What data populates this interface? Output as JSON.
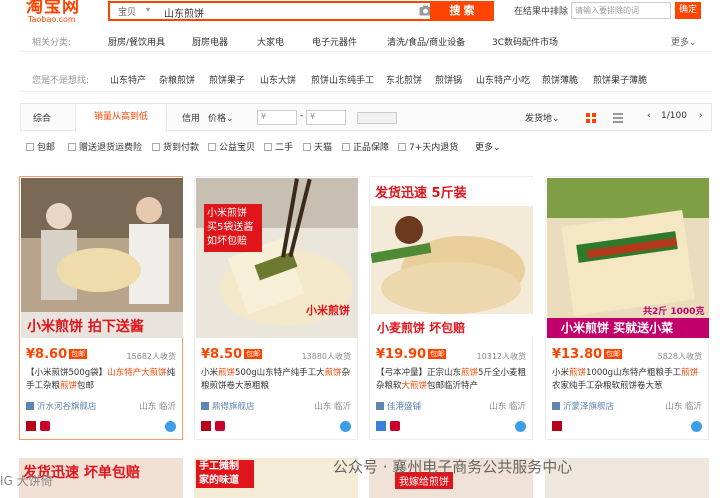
{
  "header": {
    "logo_cn": "淘宝网",
    "logo_en": "Taobao.com",
    "search_category": "宝贝",
    "search_value": "山东煎饼",
    "search_button": "搜 索",
    "rank_label": "在结果中排除",
    "rank_placeholder": "请输入要排除的词",
    "rank_button": "确定"
  },
  "related": {
    "label": "相关分类:",
    "items": [
      "厨房/餐饮用具",
      "厨房电器",
      "大家电",
      "电子元器件",
      "清洗/食品/商业设备",
      "3C数码配件市场"
    ],
    "more": "更多⌄"
  },
  "suggest": {
    "label": "您是不是想找:",
    "items": [
      "山东特产",
      "杂粮煎饼",
      "煎饼果子",
      "山东大饼",
      "煎饼山东纯手工",
      "东北煎饼",
      "煎饼锅",
      "山东特产小吃",
      "煎饼薄脆",
      "煎饼果子薄脆"
    ]
  },
  "sort": {
    "items": [
      "综合",
      "销量从高到低",
      "信用",
      "价格⌄"
    ],
    "price_from": "¥",
    "price_to": "¥",
    "ship_from": "发货地⌄",
    "page": "1/100"
  },
  "filters": [
    "包邮",
    "赠送退货运费险",
    "货到付款",
    "公益宝贝",
    "二手",
    "天猫",
    "正品保障",
    "7+天内退货",
    "更多⌄"
  ],
  "products": [
    {
      "price": "¥8.60",
      "tag": "包邮",
      "sold": "15682人收货",
      "title_a": "【小米煎饼500g袋】",
      "title_b": "山东特产大煎饼",
      "title_c": "纯手工杂粮",
      "title_d": "煎饼",
      "title_e": "包邮",
      "shop": "沂水河谷旗舰店",
      "loc": "山东 临沂",
      "img_top": "",
      "img_caption": "小米煎饼 拍下送酱"
    },
    {
      "price": "¥8.50",
      "tag": "包邮",
      "sold": "13880人收货",
      "title_a": "小米",
      "title_b": "煎饼",
      "title_c": "500g山东特产纯手工大",
      "title_d": "煎饼",
      "title_e": "杂粮煎饼卷大葱粗粮",
      "shop": "鼎得旗舰店",
      "loc": "山东 临沂",
      "img_top": "小米煎饼 买5袋送酱 如坏包赔",
      "img_caption": "小米煎饼"
    },
    {
      "price": "¥19.90",
      "tag": "包邮",
      "sold": "10312人收货",
      "title_a": "【弓本冲量】正宗山东",
      "title_b": "煎饼",
      "title_c": "5斤全小麦粗杂粮软",
      "title_d": "大煎饼",
      "title_e": "包邮临沂特产",
      "shop": "佳港盛铺",
      "loc": "山东 临沂",
      "img_top": "发货迅速 5斤装",
      "img_caption": "小麦煎饼 坏包赔"
    },
    {
      "price": "¥13.80",
      "tag": "包邮",
      "sold": "5828人收货",
      "title_a": "小米",
      "title_b": "煎饼",
      "title_c": "1000g山东特产粗粮手工",
      "title_d": "煎饼",
      "title_e": "农家纯手工杂粮软煎饼卷大葱",
      "shop": "沂蒙泽旗舰店",
      "loc": "山东 临沂",
      "img_top": "共2斤 1000克",
      "img_caption": "小米煎饼 买就送小菜"
    }
  ],
  "bottom_banners": [
    "发货迅速 坏单包赔",
    "手工摊制 家的味道",
    "我嫁给煎饼",
    ""
  ],
  "watermark": "公众号 · 襄州电子商务公共服务中心",
  "watermark2": "IG 大饼倚",
  "colors": {
    "accent": "#ff4400",
    "link": "#5d86b0"
  }
}
